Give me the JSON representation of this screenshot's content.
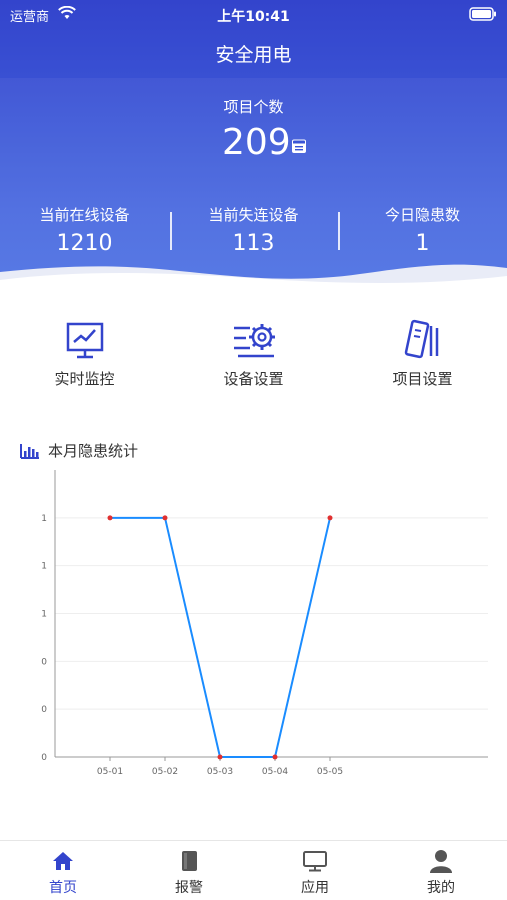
{
  "status_bar": {
    "carrier": "运营商",
    "time": "上午10:41"
  },
  "nav": {
    "title": "安全用电"
  },
  "summary": {
    "project_label": "项目个数",
    "project_count": "209",
    "stats": [
      {
        "label": "当前在线设备",
        "value": "1210"
      },
      {
        "label": "当前失连设备",
        "value": "113"
      },
      {
        "label": "今日隐患数",
        "value": "1"
      }
    ]
  },
  "quick_actions": [
    {
      "label": "实时监控",
      "icon": "monitor-chart-icon"
    },
    {
      "label": "设备设置",
      "icon": "gear-settings-icon"
    },
    {
      "label": "项目设置",
      "icon": "project-device-icon"
    }
  ],
  "section": {
    "title": "本月隐患统计",
    "icon": "bar-chart-icon"
  },
  "chart_data": {
    "type": "line",
    "x": [
      "05-01",
      "05-02",
      "05-03",
      "05-04",
      "05-05"
    ],
    "values": [
      1,
      1,
      0,
      0,
      1
    ],
    "y_tick_labels": [
      "0",
      "0",
      "0",
      "1",
      "1",
      "1"
    ],
    "ylim": [
      0,
      1.2
    ],
    "grid": true,
    "line_color": "#1a8cff",
    "point_color": "#e03030"
  },
  "tabbar": {
    "items": [
      {
        "label": "首页",
        "icon": "home-icon",
        "active": true
      },
      {
        "label": "报警",
        "icon": "alarm-book-icon",
        "active": false
      },
      {
        "label": "应用",
        "icon": "tv-app-icon",
        "active": false
      },
      {
        "label": "我的",
        "icon": "user-icon",
        "active": false
      }
    ]
  },
  "colors": {
    "primary": "#3344cc",
    "header_light": "#4f74e4"
  }
}
